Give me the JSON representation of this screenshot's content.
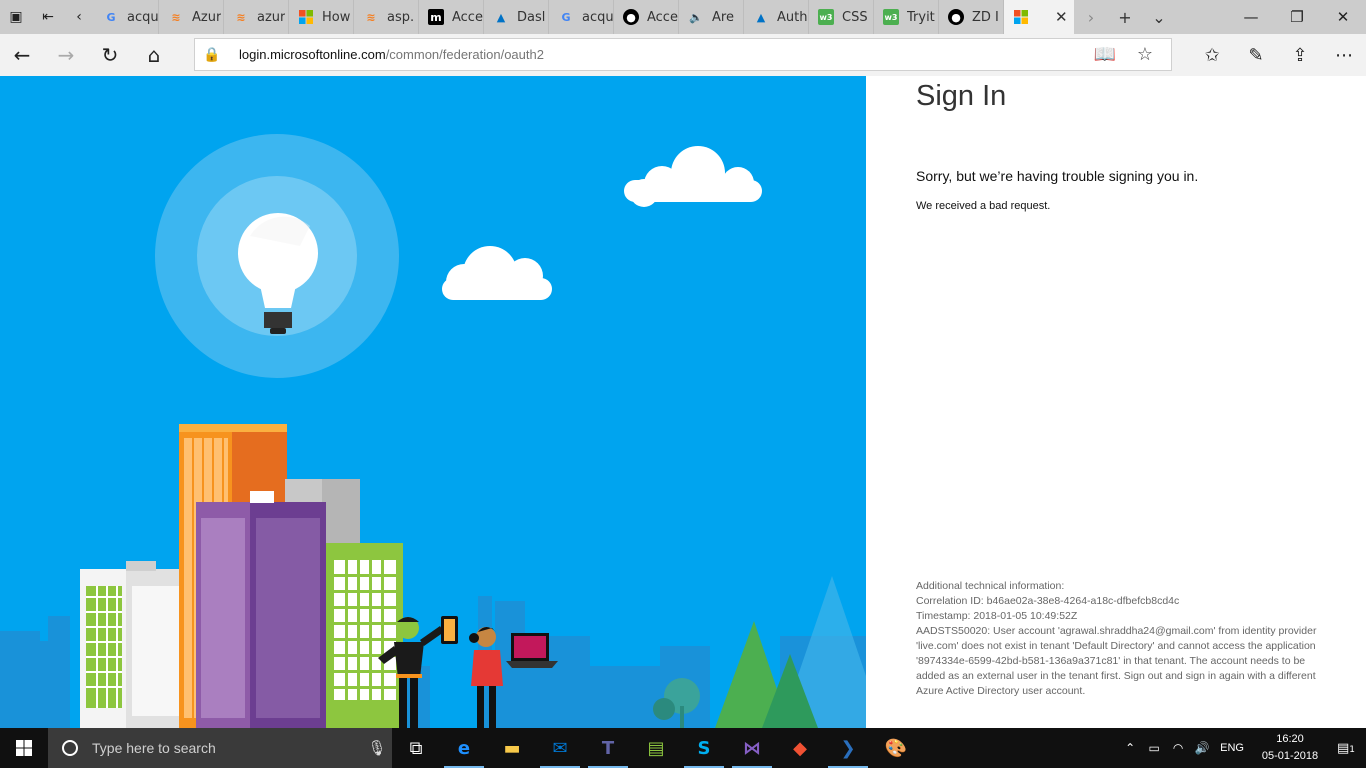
{
  "browser": {
    "tabs": [
      {
        "label": "acqu",
        "icon": "google-icon",
        "color": "#4285f4"
      },
      {
        "label": "Azur",
        "icon": "stackoverflow-icon",
        "color": "#f48024"
      },
      {
        "label": "azur",
        "icon": "stackoverflow-icon",
        "color": "#f48024"
      },
      {
        "label": "How",
        "icon": "microsoft-icon",
        "color": "#f25022"
      },
      {
        "label": "asp.",
        "icon": "stackoverflow-icon",
        "color": "#f48024"
      },
      {
        "label": "Acce",
        "icon": "medium-icon",
        "color": "#000000"
      },
      {
        "label": "Dasl",
        "icon": "azure-icon",
        "color": "#0072c6"
      },
      {
        "label": "acqu",
        "icon": "google-icon",
        "color": "#4285f4"
      },
      {
        "label": "Acce",
        "icon": "github-icon",
        "color": "#000000"
      },
      {
        "label": "Are",
        "icon": "speaker-icon",
        "color": "#444444"
      },
      {
        "label": "Auth",
        "icon": "azure-icon",
        "color": "#0072c6"
      },
      {
        "label": "CSS",
        "icon": "w3schools-icon",
        "color": "#4caf50"
      },
      {
        "label": "Tryit",
        "icon": "w3schools-icon",
        "color": "#4caf50"
      },
      {
        "label": "ZD I",
        "icon": "github-icon",
        "color": "#000000"
      }
    ],
    "active_tab": {
      "icon": "microsoft-icon",
      "close": "✕"
    },
    "address": {
      "host": "login.microsoftonline.com",
      "path": "/common/federation/oauth2"
    }
  },
  "signin": {
    "title": "Sign In",
    "error_heading": "Sorry, but we’re having trouble signing you in.",
    "error_detail": "We received a bad request.",
    "tech": {
      "header": "Additional technical information:",
      "correlation": "Correlation ID: b46ae02a-38e8-4264-a18c-dfbefcb8cd4c",
      "timestamp": "Timestamp: 2018-01-05 10:49:52Z",
      "message": "AADSTS50020: User account 'agrawal.shraddha24@gmail.com' from identity provider 'live.com' does not exist in tenant 'Default Directory' and cannot access the application '8974334e-6599-42bd-b581-136a9a371c81' in that tenant. The account needs to be added as an external user in the tenant first. Sign out and sign in again with a different Azure Active Directory user account."
    }
  },
  "taskbar": {
    "search_placeholder": "Type here to search",
    "language": "ENG",
    "time": "16:20",
    "date": "05-01-2018",
    "notifications": "1"
  },
  "colors": {
    "sky": "#00a4ef",
    "accent": "#76b9ed"
  }
}
